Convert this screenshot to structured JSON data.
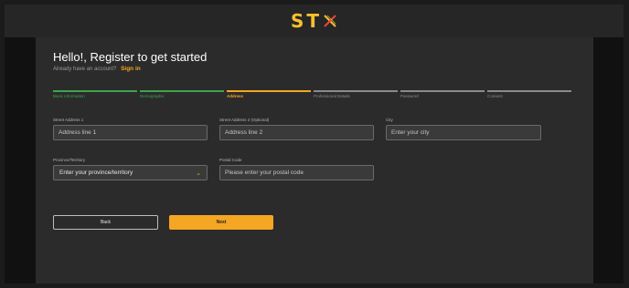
{
  "brand": {
    "logo_text": "ST",
    "accent": "#f5c12e"
  },
  "header": {
    "title": "Hello!, Register to get started",
    "subtitle": "Already have an account?",
    "signin_link": "Sign in"
  },
  "steps": [
    {
      "label": "Basic Information",
      "state": "done"
    },
    {
      "label": "Demographic",
      "state": "done"
    },
    {
      "label": "Address",
      "state": "active"
    },
    {
      "label": "Professional Details",
      "state": "pending"
    },
    {
      "label": "Password",
      "state": "pending"
    },
    {
      "label": "Consent",
      "state": "pending"
    }
  ],
  "form": {
    "street1": {
      "label": "Street Address 1",
      "placeholder": "Address line 1",
      "value": ""
    },
    "street2": {
      "label": "Street Address 2 (Optional)",
      "placeholder": "Address line 2",
      "value": ""
    },
    "city": {
      "label": "City",
      "placeholder": "Enter your city",
      "value": ""
    },
    "province": {
      "label": "Province/Territory",
      "selected": "Enter your province/territory"
    },
    "postal": {
      "label": "Postal Code",
      "placeholder": "Please enter your postal code",
      "value": ""
    }
  },
  "buttons": {
    "back": "Back",
    "next": "Next"
  },
  "colors": {
    "done": "#3fa34d",
    "active": "#f5a623",
    "pending": "#8a8a8a"
  }
}
